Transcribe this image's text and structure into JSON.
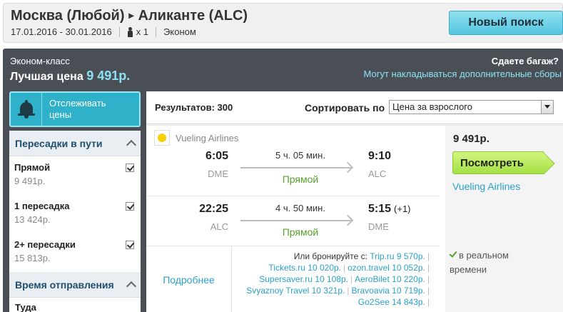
{
  "header": {
    "origin": "Москва (Любой)",
    "destination": "Аликанте (ALC)",
    "dates": "17.01.2016 - 30.01.2016",
    "passengers": "x 1",
    "cabin": "Эконом",
    "new_search_label": "Новый поиск",
    "icons": {
      "passenger": "person-icon",
      "route_arrow": "arrow-right-icon"
    }
  },
  "summary": {
    "class_label": "Эконом-класс",
    "best_price_label": "Лучшая цена",
    "best_price": "9 491р.",
    "baggage_question": "Сдаете багаж?",
    "baggage_note": "Могут накладываться дополнительные сборы"
  },
  "sidebar": {
    "track_label": "Отслеживать цены",
    "track_icon": "bell-icon",
    "stops_filter": {
      "title": "Пересадки в пути",
      "options": [
        {
          "name": "Прямой",
          "price": "9 491р.",
          "checked": true
        },
        {
          "name": "1 пересадка",
          "price": "13 424р.",
          "checked": true
        },
        {
          "name": "2+ пересадки",
          "price": "15 813р.",
          "checked": true
        }
      ]
    },
    "departure_filter": {
      "title": "Время отправления",
      "first_item": "Туда"
    }
  },
  "results": {
    "count_label": "Результатов: 300",
    "sort_label": "Сортировать по",
    "sort_value": "Цена за взрослого",
    "card": {
      "airline": "Vueling Airlines",
      "segments": [
        {
          "dep_time": "6:05",
          "dep_code": "DME",
          "duration": "5 ч. 05 мин.",
          "stops": "Прямой",
          "arr_time": "9:10",
          "arr_day_offset": "",
          "arr_code": "ALC"
        },
        {
          "dep_time": "22:25",
          "dep_code": "ALC",
          "duration": "4 ч. 50 мин.",
          "stops": "Прямой",
          "arr_time": "5:15",
          "arr_day_offset": "(+1)",
          "arr_code": "DME"
        }
      ],
      "price": "9 491р.",
      "view_label": "Посмотреть",
      "price_airline": "Vueling Airlines",
      "details_label": "Подробнее",
      "book_also_label": "Или бронируйте с:",
      "offers": [
        "Trip.ru 9 570р.",
        "Tickets.ru 10 020р.",
        "ozon.travel 10 052р.",
        "Supersaver.ru 10 108р.",
        "AeroBilet 10 220р.",
        "Svyaznoy Travel 10 321р.",
        "Bravoavia 10 719р.",
        "Go2See 14 843р."
      ],
      "realtime_label_1": "в реальном",
      "realtime_label_2": "времени"
    }
  },
  "colors": {
    "accent_cyan": "#2fb2c9",
    "link_blue": "#2aa1c9",
    "direct_green": "#58a12c",
    "dark_band": "#4a4f55",
    "view_button_green": "#a4e043"
  }
}
